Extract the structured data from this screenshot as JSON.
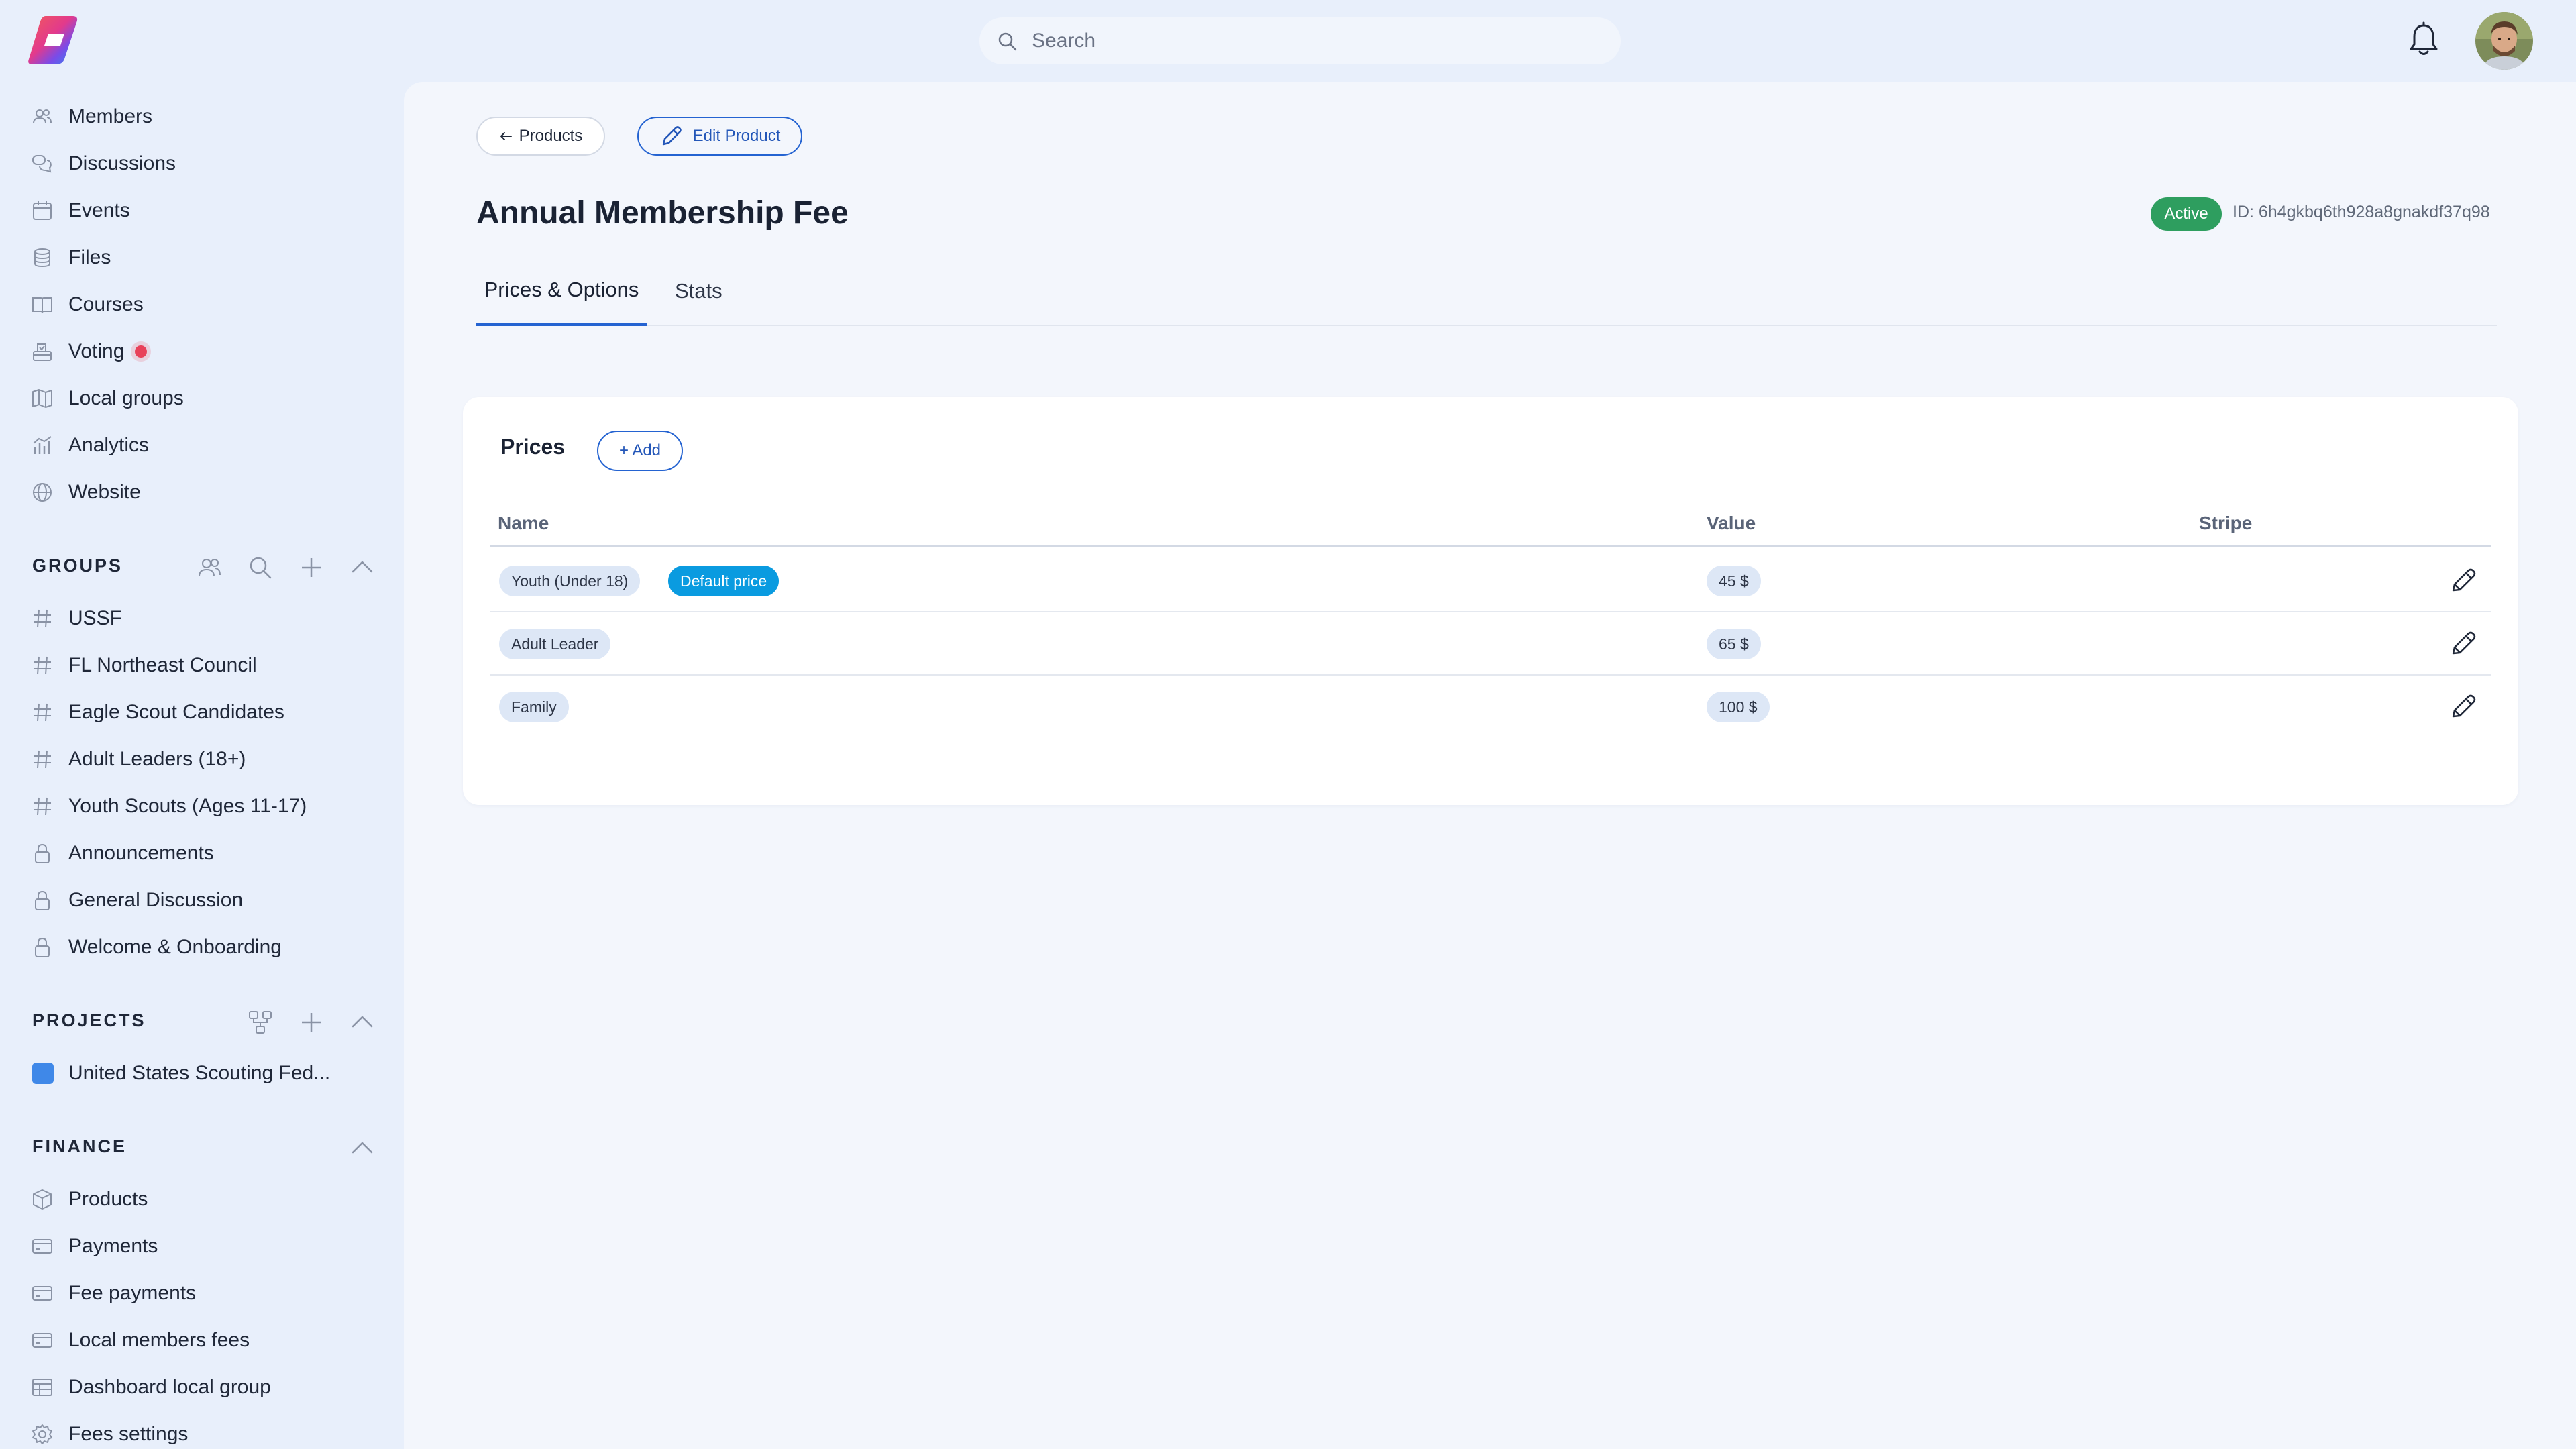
{
  "search": {
    "placeholder": "Search"
  },
  "sidebar": {
    "nav": [
      {
        "label": "Members",
        "icon": "members-icon"
      },
      {
        "label": "Discussions",
        "icon": "discussions-icon"
      },
      {
        "label": "Events",
        "icon": "calendar-icon"
      },
      {
        "label": "Files",
        "icon": "database-icon"
      },
      {
        "label": "Courses",
        "icon": "book-icon"
      },
      {
        "label": "Voting",
        "icon": "ballot-icon",
        "notification_dot": true
      },
      {
        "label": "Local groups",
        "icon": "map-icon"
      },
      {
        "label": "Analytics",
        "icon": "chart-icon"
      },
      {
        "label": "Website",
        "icon": "globe-icon"
      }
    ],
    "groups": {
      "title": "GROUPS",
      "items": [
        {
          "label": "USSF",
          "icon": "hash-icon"
        },
        {
          "label": "FL Northeast Council",
          "icon": "hash-icon"
        },
        {
          "label": "Eagle Scout Candidates",
          "icon": "hash-icon"
        },
        {
          "label": "Adult Leaders (18+)",
          "icon": "hash-icon"
        },
        {
          "label": "Youth Scouts (Ages 11-17)",
          "icon": "hash-icon"
        },
        {
          "label": "Announcements",
          "icon": "lock-icon"
        },
        {
          "label": "General Discussion",
          "icon": "lock-icon"
        },
        {
          "label": "Welcome & Onboarding",
          "icon": "lock-icon"
        }
      ]
    },
    "projects": {
      "title": "PROJECTS",
      "items": [
        {
          "label": "United States Scouting Fed...",
          "color": "#3f88e8"
        }
      ]
    },
    "finance": {
      "title": "FINANCE",
      "items": [
        {
          "label": "Products",
          "icon": "box-icon"
        },
        {
          "label": "Payments",
          "icon": "card-icon"
        },
        {
          "label": "Fee payments",
          "icon": "card-icon"
        },
        {
          "label": "Local members fees",
          "icon": "card-icon"
        },
        {
          "label": "Dashboard local group",
          "icon": "table-icon"
        },
        {
          "label": "Fees settings",
          "icon": "gear-icon"
        }
      ]
    }
  },
  "header": {
    "back_label": "Products",
    "edit_label": "Edit Product",
    "title": "Annual Membership Fee",
    "status": "Active",
    "id_text": "ID: 6h4gkbq6th928a8gnakdf37q98"
  },
  "tabs": [
    {
      "label": "Prices & Options",
      "active": true
    },
    {
      "label": "Stats",
      "active": false
    }
  ],
  "prices": {
    "title": "Prices",
    "add_label": "+ Add",
    "columns": [
      "Name",
      "Value",
      "Stripe"
    ],
    "rows": [
      {
        "name": "Youth (Under 18)",
        "default_label": "Default price",
        "value": "45 $"
      },
      {
        "name": "Adult Leader",
        "default_label": "",
        "value": "65 $"
      },
      {
        "name": "Family",
        "default_label": "",
        "value": "100 $"
      }
    ]
  },
  "colors": {
    "accent": "#2463d1",
    "active": "#2e9e5f",
    "default_chip": "#0a9be0",
    "notification": "#e8415a"
  }
}
